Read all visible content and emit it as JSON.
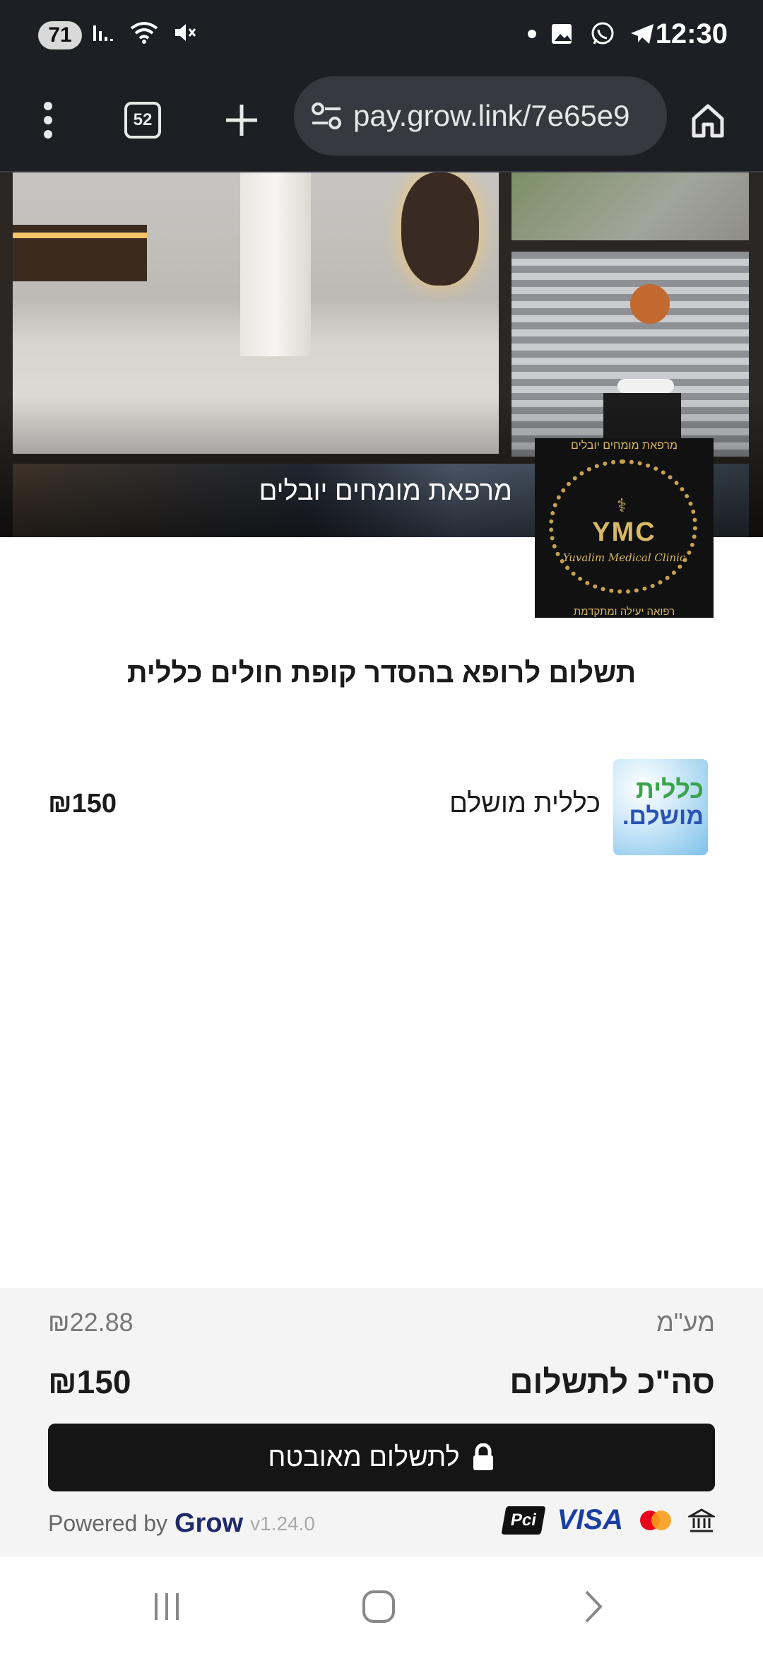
{
  "status_bar": {
    "battery": "71",
    "time": "12:30",
    "icons": [
      "signal-icon",
      "wifi-icon",
      "mute-icon",
      "dot-icon",
      "gallery-icon",
      "whatsapp-icon",
      "telegram-icon"
    ]
  },
  "browser": {
    "tabs_count": "52",
    "url": "pay.grow.link/7e65e9",
    "icons": [
      "menu-dots-icon",
      "new-tab-icon",
      "site-settings-icon",
      "home-icon"
    ]
  },
  "hero": {
    "business_name": "מרפאת מומחים יובלים"
  },
  "logo": {
    "top_text": "מרפאת מומחים יובלים",
    "initials": "YMC",
    "subtitle": "Yuvalim Medical Clinic",
    "bottom_text": "רפואה יעילה ומתקדמת"
  },
  "page": {
    "title": "תשלום לרופא בהסדר קופת חולים כללית"
  },
  "product": {
    "thumb_line1": "כללית",
    "thumb_line2": "מושלם.",
    "name": "כללית מושלם",
    "price": "₪150"
  },
  "summary": {
    "fee_label": "מע\"מ",
    "fee_value": "₪22.88",
    "total_label": "סה\"כ לתשלום",
    "total_value": "₪150",
    "pay_button": "לתשלום מאובטח",
    "powered_by": "Powered by",
    "brand": "Grow",
    "version": "v1.24.0",
    "payment_logos": {
      "pci": "Pci",
      "visa": "VISA"
    }
  },
  "colors": {
    "accent": "#151515",
    "brand": "#1f2a68",
    "panel_bg": "#f4f4f4",
    "mastercard_red": "#eb001b",
    "mastercard_orange": "#f79e1b"
  }
}
